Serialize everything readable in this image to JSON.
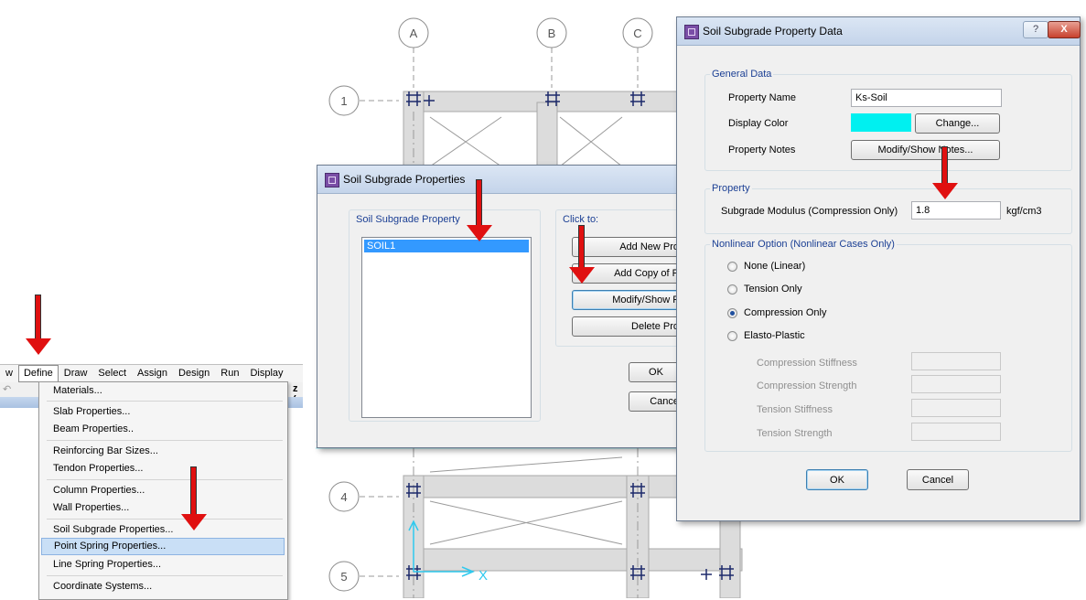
{
  "plan": {
    "column_bubbles": [
      "A",
      "B",
      "C"
    ],
    "row_bubbles": [
      "1",
      "4",
      "5"
    ],
    "axis_label": "X"
  },
  "menu": {
    "items": [
      "w",
      "Define",
      "Draw",
      "Select",
      "Assign",
      "Design",
      "Run",
      "Display"
    ],
    "toolbar_text": "z (",
    "dropdown": [
      "Materials...",
      "Slab Properties...",
      "Beam Properties..",
      "Reinforcing Bar Sizes...",
      "Tendon Properties...",
      "Column Properties...",
      "Wall Properties...",
      "Soil Subgrade Properties...",
      "Point Spring Properties...",
      "Line Spring Properties...",
      "Coordinate Systems..."
    ]
  },
  "props_dialog": {
    "title": "Soil Subgrade Properties",
    "list_label": "Soil Subgrade Property",
    "list_items": [
      "SOIL1"
    ],
    "click_to": "Click to:",
    "add_new": "Add New Pro",
    "add_copy": "Add Copy of P",
    "modify": "Modify/Show F",
    "delete": "Delete Pro",
    "ok": "OK",
    "cancel": "Cance"
  },
  "data_dialog": {
    "title": "Soil Subgrade Property Data",
    "help_glyph": "?",
    "close_glyph": "X",
    "general": {
      "title": "General Data",
      "property_name_label": "Property Name",
      "property_name_value": "Ks-Soil",
      "display_color_label": "Display Color",
      "display_color": "#00f0f0",
      "change_button": "Change...",
      "notes_label": "Property Notes",
      "notes_button": "Modify/Show Notes..."
    },
    "property": {
      "title": "Property",
      "modulus_label": "Subgrade Modulus  (Compression Only)",
      "modulus_value": "1.8",
      "modulus_unit": "kgf/cm3"
    },
    "nonlinear": {
      "title": "Nonlinear Option  (Nonlinear Cases Only)",
      "options": [
        "None (Linear)",
        "Tension Only",
        "Compression Only",
        "Elasto-Plastic"
      ],
      "selected": "Compression Only",
      "params": [
        "Compression Stiffness",
        "Compression Strength",
        "Tension Stiffness",
        "Tension Strength"
      ]
    },
    "ok": "OK",
    "cancel": "Cancel"
  },
  "colors": {
    "arrow": "#e01010",
    "selection": "#3399ff",
    "slab": "#dcdcdc"
  }
}
